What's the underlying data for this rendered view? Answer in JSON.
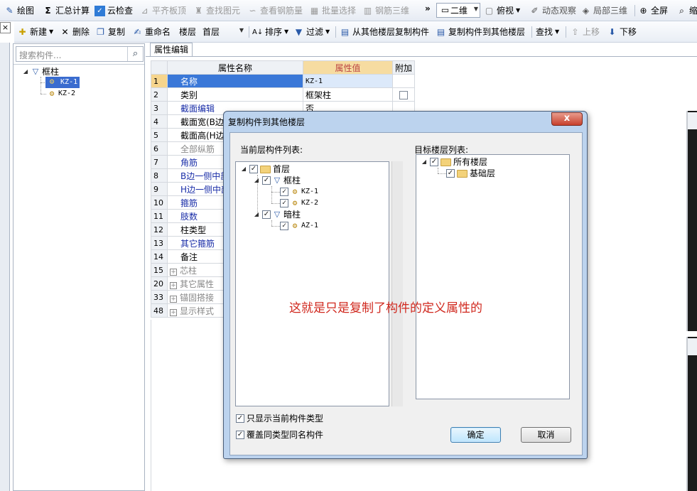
{
  "toolbar1": {
    "items": [
      {
        "label": "绘图",
        "icon": "draw-icon",
        "disabled": false
      },
      {
        "label": "汇总计算",
        "icon": "sigma-icon",
        "disabled": false
      },
      {
        "label": "云检查",
        "icon": "cloud-check-icon",
        "disabled": false
      },
      {
        "label": "平齐板顶",
        "icon": "align-top-icon",
        "disabled": true
      },
      {
        "label": "查找图元",
        "icon": "find-element-icon",
        "disabled": true
      },
      {
        "label": "查看钢筋量",
        "icon": "rebar-quantity-icon",
        "disabled": true
      },
      {
        "label": "批量选择",
        "icon": "batch-select-icon",
        "disabled": true
      },
      {
        "label": "钢筋三维",
        "icon": "rebar-3d-icon",
        "disabled": true
      }
    ],
    "overflow": "»",
    "view_combo": "二维",
    "right_items": [
      {
        "label": "俯视",
        "icon": "top-view-icon"
      },
      {
        "label": "动态观察",
        "icon": "orbit-icon"
      },
      {
        "label": "局部三维",
        "icon": "local-3d-icon"
      },
      {
        "label": "全屏",
        "icon": "fullscreen-icon"
      },
      {
        "label": "缩",
        "icon": "zoom-icon"
      }
    ]
  },
  "toolbar2": {
    "new": "新建",
    "delete": "删除",
    "copy": "复制",
    "rename": "重命名",
    "floor_label": "楼层",
    "floor_value": "首层",
    "sort": "排序",
    "filter": "过滤",
    "copy_from": "从其他楼层复制构件",
    "copy_to": "复制构件到其他楼层",
    "find": "查找",
    "move_up": "上移",
    "move_down": "下移"
  },
  "left_panel": {
    "close": "×",
    "search_placeholder": "搜索构件...",
    "tree": {
      "root": "框柱",
      "children": [
        "KZ-1",
        "KZ-2"
      ],
      "selected": "KZ-1"
    }
  },
  "property_panel": {
    "tab": "属性编辑",
    "headers": {
      "name": "属性名称",
      "value": "属性值",
      "extra": "附加"
    },
    "rows": [
      {
        "no": "1",
        "name": "名称",
        "value": "KZ-1"
      },
      {
        "no": "2",
        "name": "类别",
        "value": "框架柱"
      },
      {
        "no": "3",
        "name": "截面编辑",
        "value": "否"
      },
      {
        "no": "4",
        "name": "截面宽(B边",
        "value": ""
      },
      {
        "no": "5",
        "name": "截面高(H边",
        "value": ""
      },
      {
        "no": "6",
        "name": "全部纵筋",
        "value": ""
      },
      {
        "no": "7",
        "name": "角筋",
        "value": ""
      },
      {
        "no": "8",
        "name": "B边一侧中部",
        "value": ""
      },
      {
        "no": "9",
        "name": "H边一侧中部",
        "value": ""
      },
      {
        "no": "10",
        "name": "箍筋",
        "value": ""
      },
      {
        "no": "11",
        "name": "肢数",
        "value": ""
      },
      {
        "no": "12",
        "name": "柱类型",
        "value": ""
      },
      {
        "no": "13",
        "name": "其它箍筋",
        "value": ""
      },
      {
        "no": "14",
        "name": "备注",
        "value": ""
      },
      {
        "no": "15",
        "name": "芯柱",
        "value": ""
      },
      {
        "no": "20",
        "name": "其它属性",
        "value": ""
      },
      {
        "no": "33",
        "name": "锚固搭接",
        "value": ""
      },
      {
        "no": "48",
        "name": "显示样式",
        "value": ""
      }
    ]
  },
  "dialog": {
    "title": "复制构件到其他楼层",
    "close": "x",
    "left_label": "当前层构件列表:",
    "right_label": "目标楼层列表:",
    "left_tree": {
      "floor": "首层",
      "groups": [
        {
          "name": "框柱",
          "items": [
            "KZ-1",
            "KZ-2"
          ]
        },
        {
          "name": "暗柱",
          "items": [
            "AZ-1"
          ]
        }
      ]
    },
    "right_tree": {
      "root": "所有楼层",
      "child": "基础层"
    },
    "option1": "只显示当前构件类型",
    "option2": "覆盖同类型同名构件",
    "ok": "确定",
    "cancel": "取消"
  },
  "annotation": "这就是只是复制了构件的定义属性的",
  "colors": {
    "selection": "#3a6ccf",
    "annotation": "#d0281e",
    "dialog_frame": "#bcd3ee",
    "header_value": "#f6dca1"
  }
}
